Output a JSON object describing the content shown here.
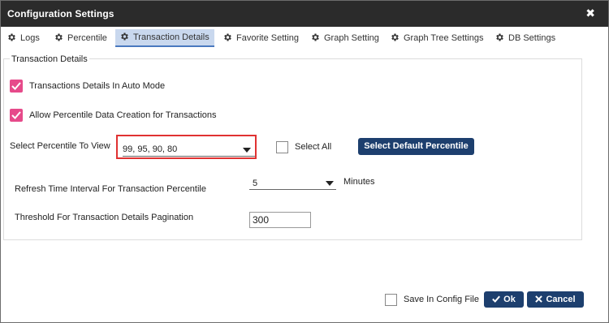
{
  "window": {
    "title": "Configuration Settings",
    "close_glyph": "✖"
  },
  "tabs": [
    {
      "label": "Logs",
      "icon": "gear-icon",
      "active": false
    },
    {
      "label": "Percentile",
      "icon": "gear-icon",
      "active": false
    },
    {
      "label": "Transaction Details",
      "icon": "gear-icon",
      "active": true
    },
    {
      "label": "Favorite Setting",
      "icon": "gear-icon",
      "active": false
    },
    {
      "label": "Graph Setting",
      "icon": "gear-icon",
      "active": false
    },
    {
      "label": "Graph Tree Settings",
      "icon": "gear-icon",
      "active": false
    },
    {
      "label": "DB Settings",
      "icon": "gear-icon",
      "active": false
    }
  ],
  "section": {
    "legend": "Transaction Details",
    "auto_mode": {
      "label": "Transactions Details In Auto Mode",
      "checked": true
    },
    "allow_percentile": {
      "label": "Allow Percentile Data Creation for Transactions",
      "checked": true
    },
    "percentile": {
      "label": "Select Percentile To View",
      "value": "99, 95, 90, 80",
      "select_all_label": "Select All",
      "select_all_checked": false,
      "default_button": "Select Default Percentile"
    },
    "refresh": {
      "label": "Refresh Time Interval For Transaction Percentile",
      "value": "5",
      "unit": "Minutes"
    },
    "pagination": {
      "label": "Threshold For Transaction Details Pagination",
      "value": "300"
    }
  },
  "footer": {
    "save_config_label": "Save In Config File",
    "save_config_checked": false,
    "ok_label": "Ok",
    "cancel_label": "Cancel"
  },
  "colors": {
    "titlebar": "#2b2b2b",
    "active_tab": "#c9d8ee",
    "checkbox_checked": "#e64a8a",
    "primary_button": "#1d3f6e",
    "highlight_border": "#e03232"
  }
}
